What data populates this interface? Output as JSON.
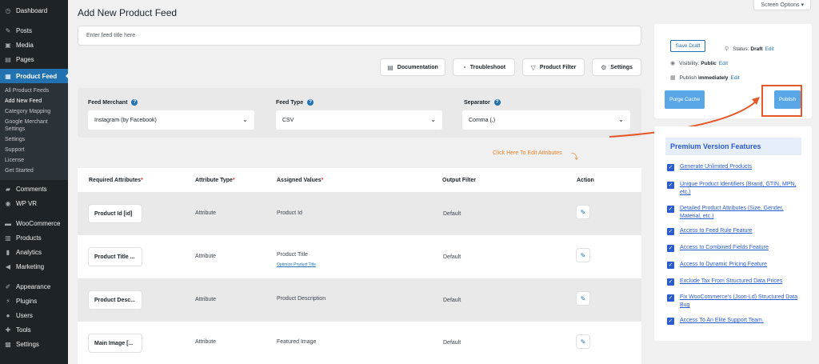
{
  "sidebar": {
    "top": [
      {
        "label": "Dashboard",
        "icon": "dashboard-icon"
      },
      {
        "label": "Posts",
        "icon": "pin-icon"
      },
      {
        "label": "Media",
        "icon": "media-icon"
      },
      {
        "label": "Pages",
        "icon": "pages-icon"
      }
    ],
    "active": {
      "label": "Product Feed",
      "icon": "feed-icon"
    },
    "sub": [
      "All Product Feeds",
      "Add New Feed",
      "Category Mapping",
      "Google Merchant Settings",
      "Settings",
      "Support",
      "License",
      "Get Started"
    ],
    "group2": [
      {
        "label": "Comments",
        "icon": "comment-icon"
      },
      {
        "label": "WP VR",
        "icon": "vr-icon"
      }
    ],
    "group3": [
      {
        "label": "WooCommerce",
        "icon": "woo-icon"
      },
      {
        "label": "Products",
        "icon": "products-icon"
      },
      {
        "label": "Analytics",
        "icon": "analytics-icon"
      },
      {
        "label": "Marketing",
        "icon": "megaphone-icon"
      }
    ],
    "group4": [
      {
        "label": "Appearance",
        "icon": "brush-icon"
      },
      {
        "label": "Plugins",
        "icon": "plug-icon"
      },
      {
        "label": "Users",
        "icon": "user-icon"
      },
      {
        "label": "Tools",
        "icon": "wrench-icon"
      },
      {
        "label": "Settings",
        "icon": "settings-icon"
      }
    ]
  },
  "header": {
    "screen_options": "Screen Options ▾",
    "title": "Add New Product Feed",
    "feed_title_placeholder": "Enter feed title here"
  },
  "toolbar": {
    "documentation": "Documentation",
    "troubleshoot": "Troubleshoot",
    "product_filter": "Product Filter",
    "settings": "Settings"
  },
  "merchant": {
    "merchant_label": "Feed Merchant",
    "merchant_value": "Instagram (by Facebook)",
    "type_label": "Feed Type",
    "type_value": "CSV",
    "separator_label": "Separator",
    "separator_value": "Comma (,)"
  },
  "annotation": "Click Here To Edit Attributes",
  "table": {
    "headers": {
      "required": "Required Attributes",
      "type": "Attribute Type",
      "assigned": "Assigned Values",
      "output": "Output Filter",
      "action": "Action",
      "req_mark": "*"
    },
    "rows": [
      {
        "attr": "Product Id [id]",
        "type": "Attribute",
        "value": "Product Id",
        "filter": "Default",
        "link": ""
      },
      {
        "attr": "Product Title ...",
        "type": "Attribute",
        "value": "Product Title",
        "filter": "Default",
        "link": "Optimize Product Title"
      },
      {
        "attr": "Product Desc...",
        "type": "Attribute",
        "value": "Product Description",
        "filter": "Default",
        "link": ""
      },
      {
        "attr": "Main Image [...",
        "type": "Attribute",
        "value": "Featured Image",
        "filter": "Default",
        "link": ""
      }
    ]
  },
  "publish": {
    "save_draft": "Save Draft",
    "status_label": "Status:",
    "status_value": "Draft",
    "visibility_label": "Visibility:",
    "visibility_value": "Public",
    "publish_label": "Publish",
    "publish_value": "immediately",
    "edit": "Edit",
    "purge_cache": "Purge Cache",
    "publish_button": "Publish"
  },
  "premium": {
    "title": "Premium Version Features",
    "features": [
      "Generate Unlimited Products",
      "Unique Product Identifiers (Brand, GTIN, MPN, etc.)",
      "Detailed Product Attributes (Size, Gender, Material, etc.)",
      "Access to Feed Rule Feature",
      "Access to Combined Fields Feature",
      "Access to Dynamic Pricing Feature",
      "Exclude Tax From Structured Data Prices",
      "Fix WooCommerce's (Json-Ld) Structured Data Bug",
      "Access To An Elite Support Team."
    ]
  },
  "colors": {
    "sidebar_bg": "#1d2327",
    "active_blue": "#2271b1",
    "annotation_orange": "#e9832b",
    "highlight_red": "#e4582a",
    "premium_blue": "#2a5bd0"
  }
}
